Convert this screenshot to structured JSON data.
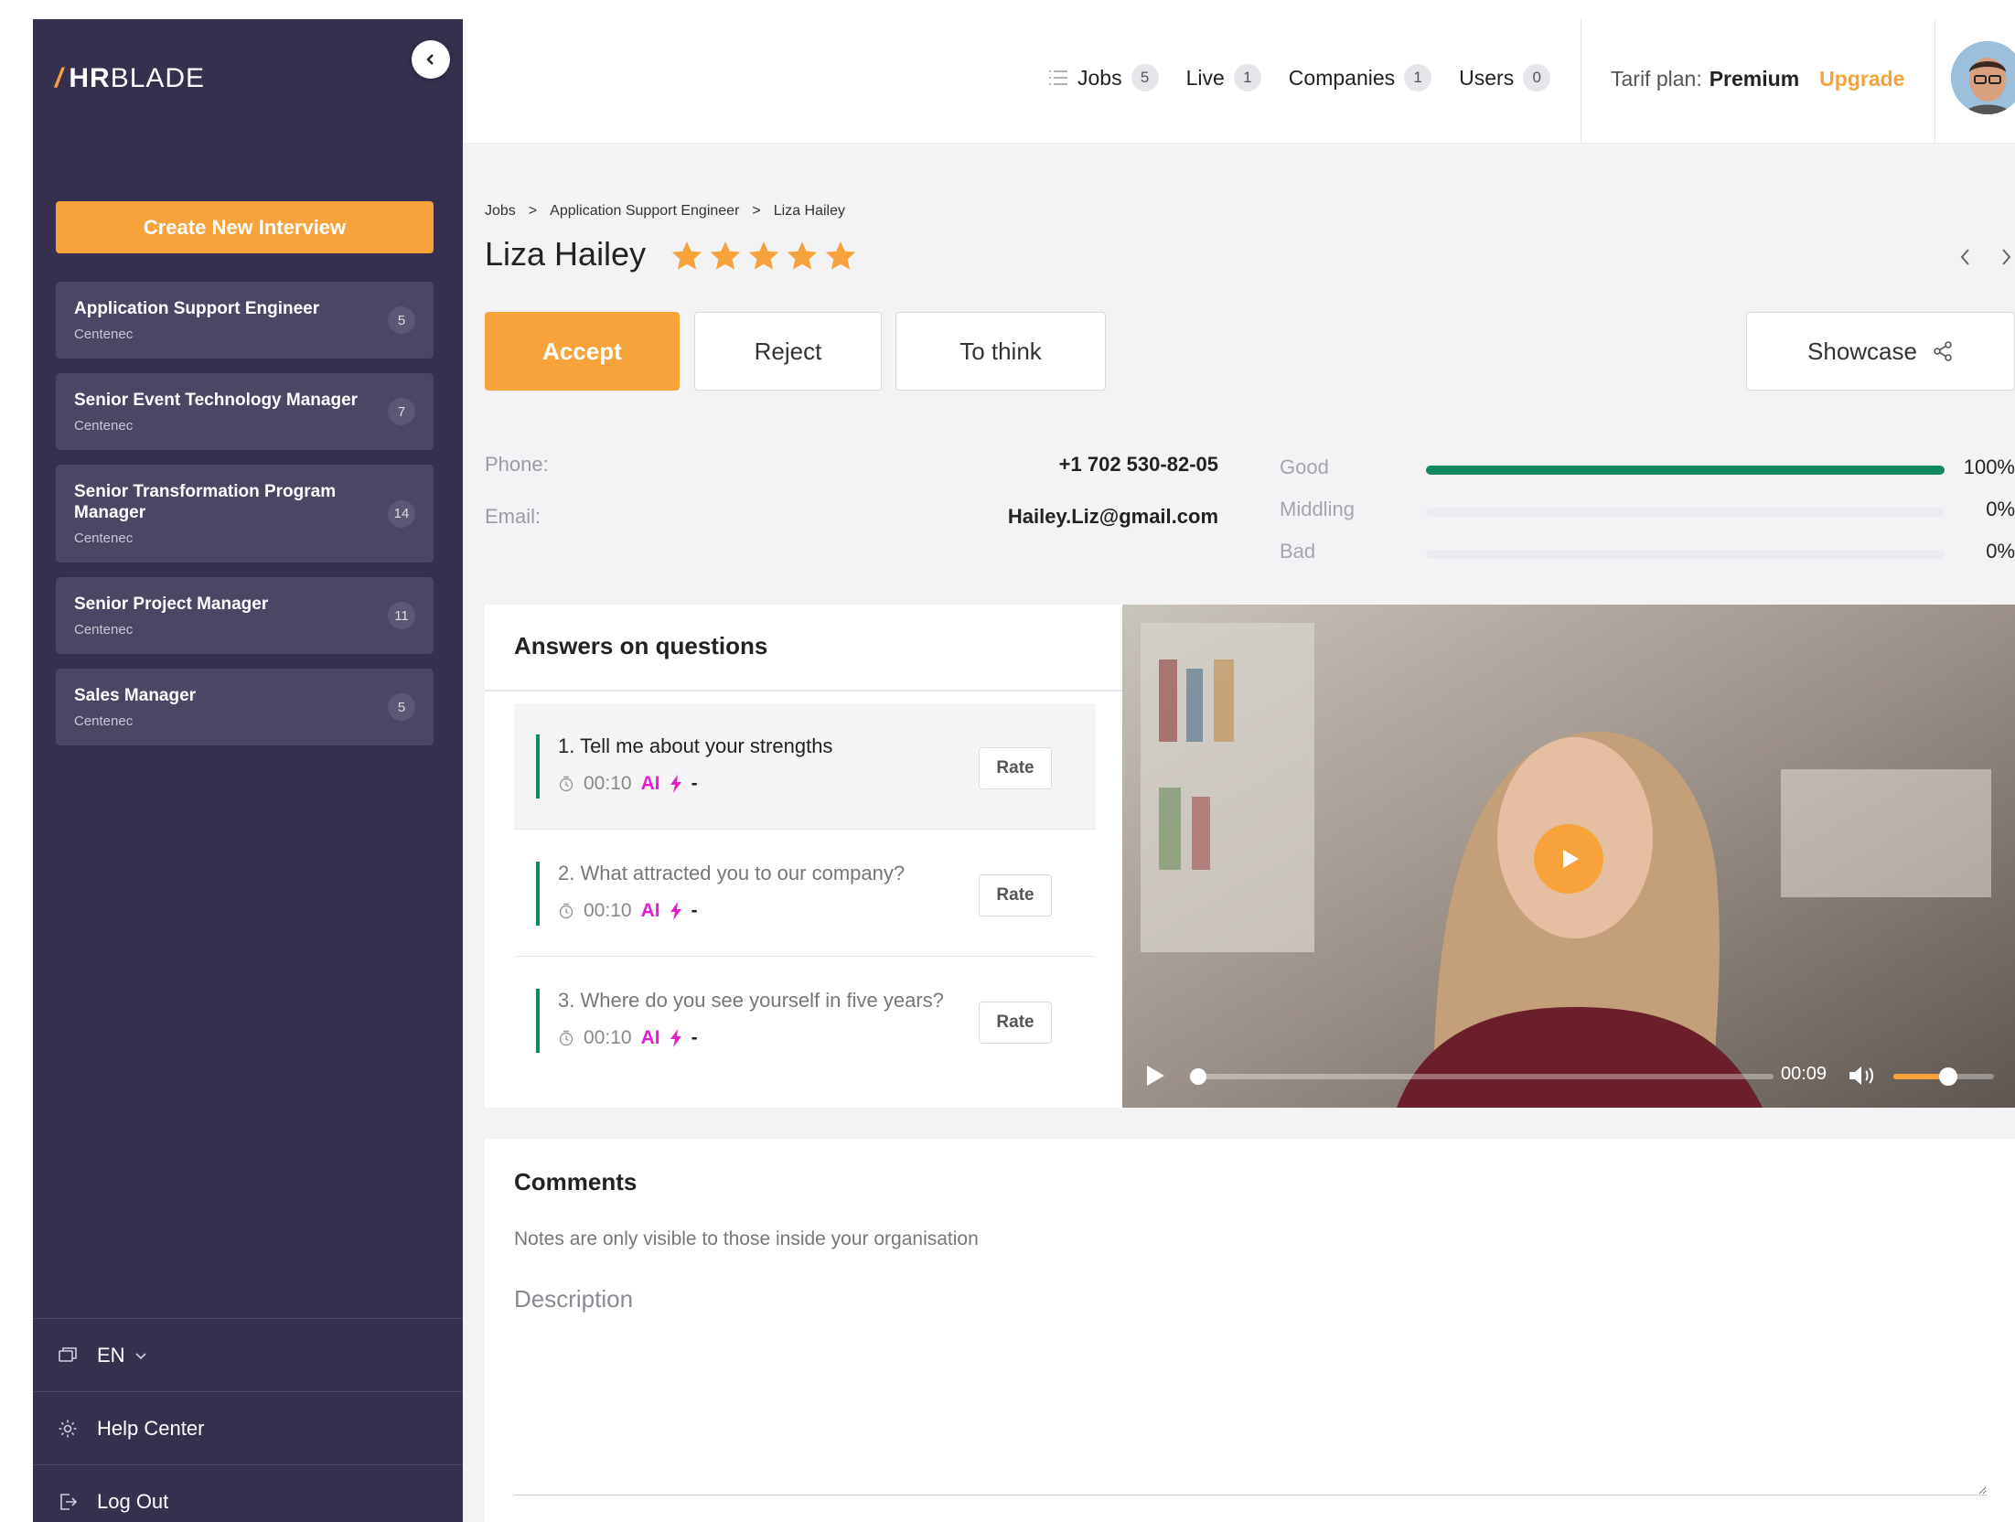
{
  "brand": {
    "logo_mark": "/",
    "logo_hr": "HR",
    "logo_blade": "BLADE",
    "accent": "#f7a23b"
  },
  "sidebar": {
    "create_label": "Create New Interview",
    "jobs": [
      {
        "title": "Application Support Engineer",
        "company": "Centenec",
        "count": "5"
      },
      {
        "title": "Senior Event Technology Manager",
        "company": "Centenec",
        "count": "7"
      },
      {
        "title": "Senior Transformation Program Manager",
        "company": "Centenec",
        "count": "14"
      },
      {
        "title": "Senior Project Manager",
        "company": "Centenec",
        "count": "11"
      },
      {
        "title": "Sales Manager",
        "company": "Centenec",
        "count": "5"
      }
    ],
    "language": "EN",
    "help": "Help Center",
    "logout": "Log Out"
  },
  "header": {
    "nav": [
      {
        "label": "Jobs",
        "count": "5"
      },
      {
        "label": "Live",
        "count": "1"
      },
      {
        "label": "Companies",
        "count": "1"
      },
      {
        "label": "Users",
        "count": "0"
      }
    ],
    "tarif_label": "Tarif plan:",
    "tarif_plan": "Premium",
    "upgrade": "Upgrade"
  },
  "breadcrumb": [
    "Jobs",
    ">",
    "Application Support Engineer",
    ">",
    "Liza Hailey"
  ],
  "candidate": {
    "name": "Liza Hailey",
    "rating": 5,
    "phone_label": "Phone:",
    "phone": "+1 702 530-82-05",
    "email_label": "Email:",
    "email": "Hailey.Liz@gmail.com"
  },
  "actions": {
    "accept": "Accept",
    "reject": "Reject",
    "think": "To think",
    "showcase": "Showcase"
  },
  "scores": [
    {
      "label": "Good",
      "percent": 100,
      "text": "100%",
      "color": "#0f8a5f"
    },
    {
      "label": "Middling",
      "percent": 0,
      "text": "0%",
      "color": "#f7a23b"
    },
    {
      "label": "Bad",
      "percent": 0,
      "text": "0%",
      "color": "#d9534f"
    }
  ],
  "answers": {
    "title": "Answers on questions",
    "questions": [
      {
        "text": "1. Tell me about your strengths",
        "time": "00:10",
        "ai": "AI",
        "ai_value": "-",
        "rate": "Rate"
      },
      {
        "text": "2. What attracted you to our company?",
        "time": "00:10",
        "ai": "AI",
        "ai_value": "-",
        "rate": "Rate"
      },
      {
        "text": "3. Where do you see yourself in five years?",
        "time": "00:10",
        "ai": "AI",
        "ai_value": "-",
        "rate": "Rate"
      }
    ]
  },
  "video": {
    "time": "00:09",
    "progress": 0.0,
    "volume": 0.6
  },
  "comments": {
    "title": "Comments",
    "note": "Notes are only visible to those inside your organisation",
    "placeholder": "Description"
  }
}
